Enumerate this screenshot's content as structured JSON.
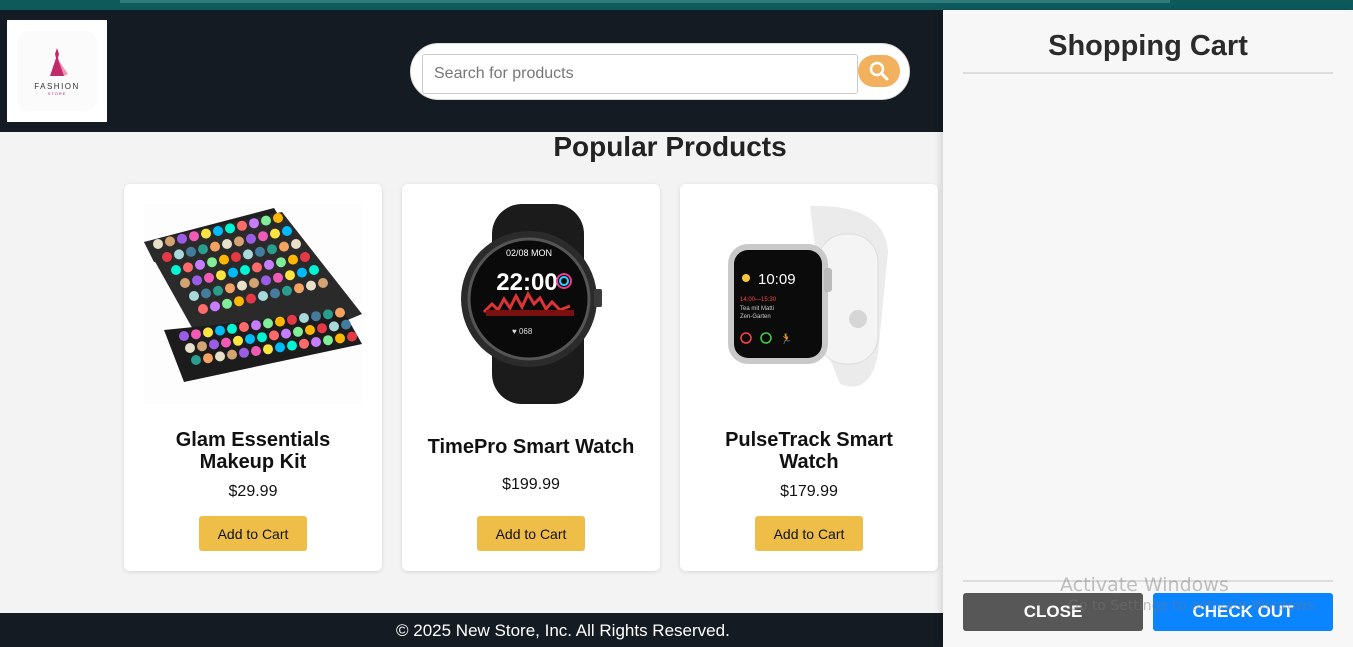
{
  "header": {
    "logo": {
      "word": "FASHION",
      "sub": "STORE"
    },
    "search": {
      "placeholder": "Search for products",
      "value": "",
      "icon": "search-icon",
      "button_color": "#f2b15f"
    }
  },
  "main": {
    "section_title": "Popular Products",
    "products": [
      {
        "name": "Glam Essentials Makeup Kit",
        "price": "$29.99",
        "button": "Add to Cart",
        "image": "makeup-palette-image"
      },
      {
        "name": "TimePro Smart Watch",
        "price": "$199.99",
        "button": "Add to Cart",
        "image": "black-smartwatch-image",
        "watch_time": "22:00",
        "watch_date": "02/08 MON"
      },
      {
        "name": "PulseTrack Smart Watch",
        "price": "$179.99",
        "button": "Add to Cart",
        "image": "white-smartwatch-image",
        "watch_time": "10:09"
      }
    ]
  },
  "footer": {
    "text": "© 2025 New Store, Inc. All Rights Reserved."
  },
  "cart": {
    "title": "Shopping Cart",
    "close_label": "CLOSE",
    "checkout_label": "CHECK OUT",
    "items": []
  },
  "watermark": {
    "line1": "Activate Windows",
    "line2": "Go to Settings to activate Windows."
  },
  "colors": {
    "header_bg": "#141b22",
    "accent_button": "#eebe48",
    "checkout": "#0b84ff",
    "close": "#575757"
  }
}
